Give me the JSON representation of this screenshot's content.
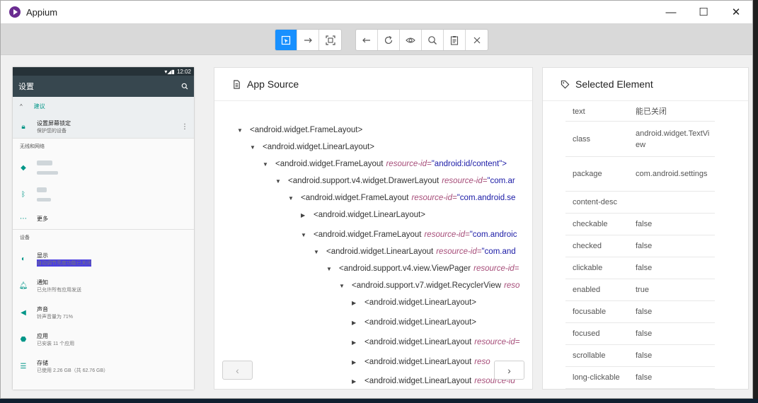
{
  "window": {
    "title": "Appium",
    "controls": {
      "minimize": "—",
      "maximize": "☐",
      "close": "✕"
    }
  },
  "device": {
    "status_time": "12:02",
    "app_title": "设置",
    "suggestion_label": "建议",
    "lock": {
      "title": "设置屏幕锁定",
      "subtitle": "保护您的设备"
    },
    "section_wireless": "无线和网络",
    "more": "更多",
    "section_device": "设备",
    "items": [
      {
        "title": "显示",
        "subtitle": "自动调节亮度功能已关闭"
      },
      {
        "title": "通知",
        "subtitle": "已允许所有应用发送"
      },
      {
        "title": "声音",
        "subtitle": "铃声音量为 71%"
      },
      {
        "title": "应用",
        "subtitle": "已安装 11 个应用"
      },
      {
        "title": "存储",
        "subtitle": "已使用 2.26 GB（共 62.76 GB）"
      }
    ]
  },
  "source_panel": {
    "title": "App Source",
    "nodes": [
      {
        "text": "<android.widget.FrameLayout>",
        "attr": "",
        "val": ""
      },
      {
        "text": "<android.widget.LinearLayout>",
        "attr": "",
        "val": ""
      },
      {
        "text": "<android.widget.FrameLayout",
        "attr": "resource-id=",
        "val": "\"android:id/content\">"
      },
      {
        "text": "<android.support.v4.widget.DrawerLayout",
        "attr": "resource-id=",
        "val": "\"com.ar"
      },
      {
        "text": "<android.widget.FrameLayout",
        "attr": "resource-id=",
        "val": "\"com.android.se"
      },
      {
        "text": "<android.widget.LinearLayout>",
        "attr": "",
        "val": ""
      },
      {
        "text": "<android.widget.FrameLayout",
        "attr": "resource-id=",
        "val": "\"com.androic"
      },
      {
        "text": "<android.widget.LinearLayout",
        "attr": "resource-id=",
        "val": "\"com.and"
      },
      {
        "text": "<android.support.v4.view.ViewPager",
        "attr": "resource-id=",
        "val": ""
      },
      {
        "text": "<android.support.v7.widget.RecyclerView",
        "attr": "reso",
        "val": ""
      },
      {
        "text": "<android.widget.LinearLayout>",
        "attr": "",
        "val": ""
      },
      {
        "text": "<android.widget.LinearLayout>",
        "attr": "",
        "val": ""
      },
      {
        "text": "<android.widget.LinearLayout",
        "attr": "resource-id=",
        "val": ""
      },
      {
        "text": "<android.widget.LinearLayout",
        "attr": "reso",
        "val": ""
      },
      {
        "text": "<android.widget.LinearLayout",
        "attr": "resource-id",
        "val": ""
      }
    ],
    "prev_label": "‹",
    "next_label": "›"
  },
  "selected_panel": {
    "title": "Selected Element",
    "rows": [
      {
        "key": "text",
        "value": "能已关闭"
      },
      {
        "key": "class",
        "value": "android.widget.TextView"
      },
      {
        "key": "package",
        "value": "com.android.settings"
      },
      {
        "key": "content-desc",
        "value": ""
      },
      {
        "key": "checkable",
        "value": "false"
      },
      {
        "key": "checked",
        "value": "false"
      },
      {
        "key": "clickable",
        "value": "false"
      },
      {
        "key": "enabled",
        "value": "true"
      },
      {
        "key": "focusable",
        "value": "false"
      },
      {
        "key": "focused",
        "value": "false"
      },
      {
        "key": "scrollable",
        "value": "false"
      },
      {
        "key": "long-clickable",
        "value": "false"
      }
    ]
  }
}
